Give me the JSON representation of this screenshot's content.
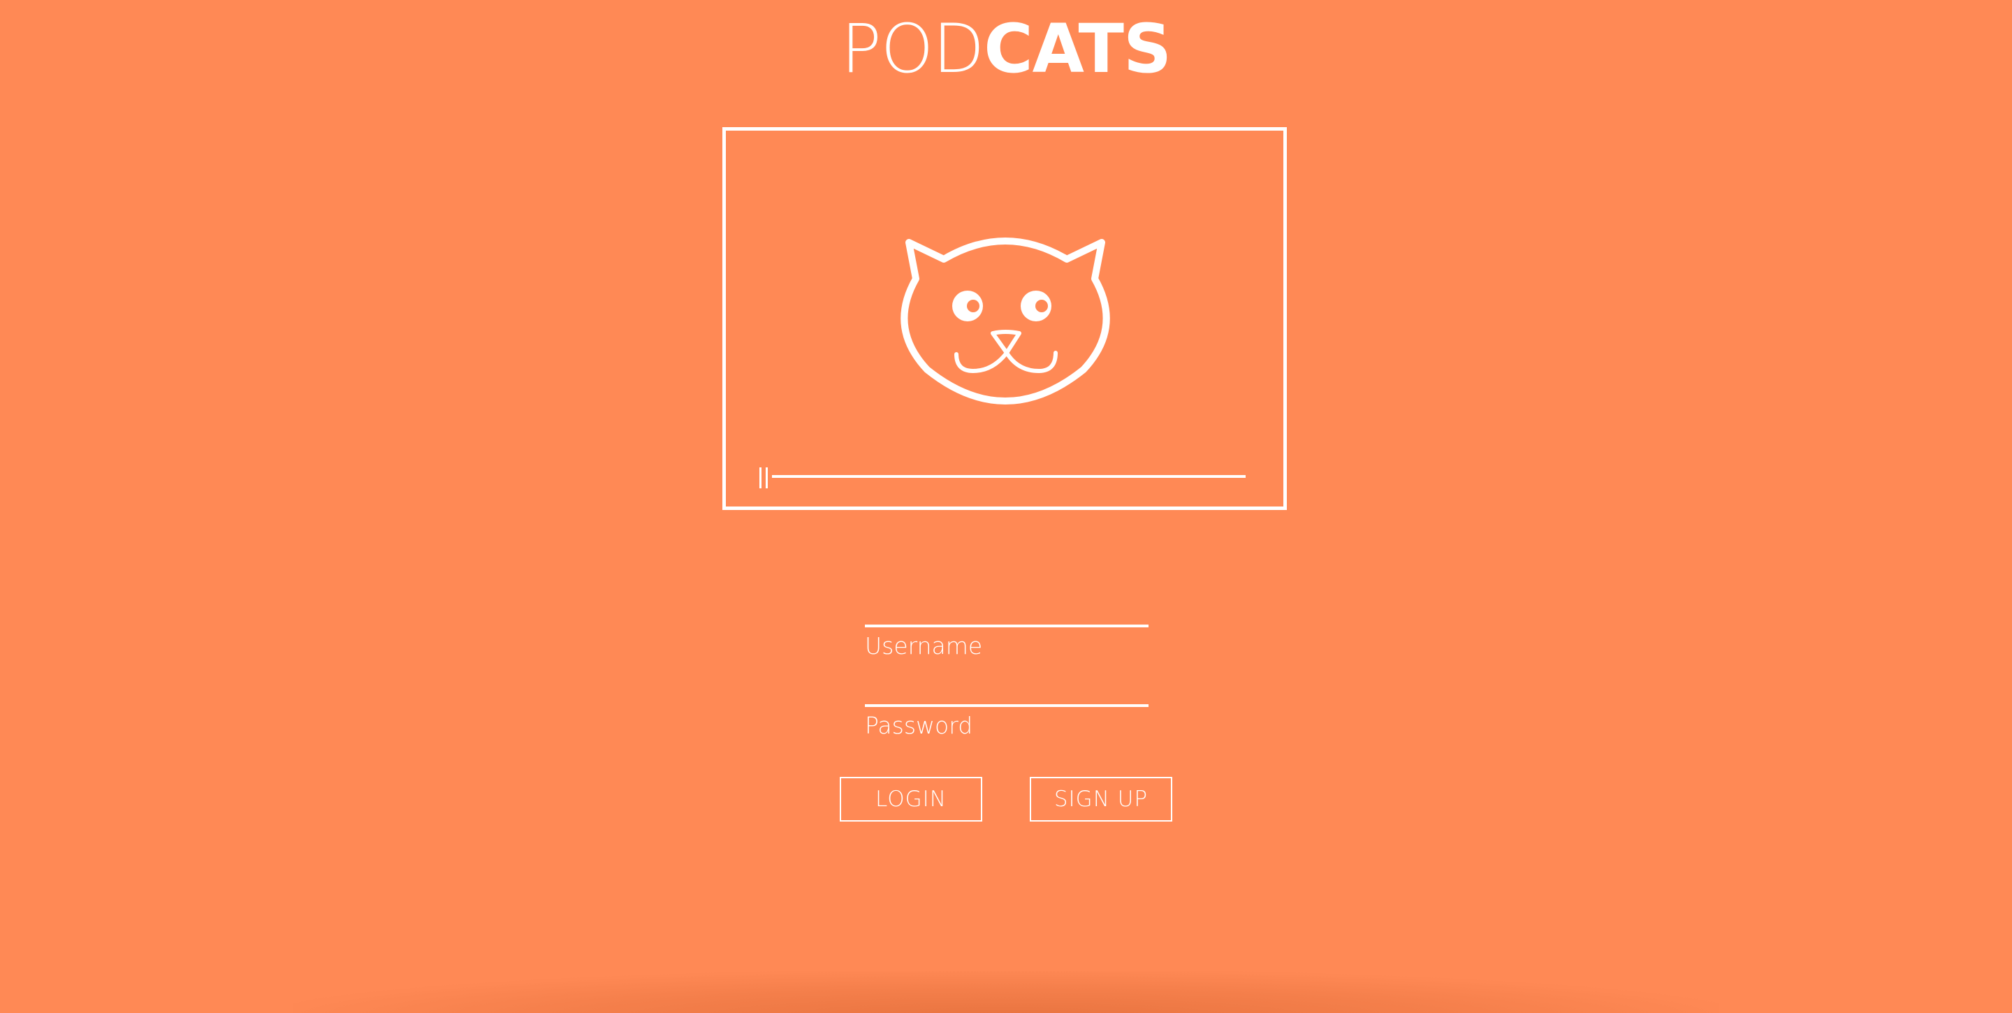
{
  "brand": {
    "prefix": "POD",
    "suffix": "CATS"
  },
  "player": {
    "icon": "cat-face-icon",
    "control_icon": "pause-icon",
    "progress": 0
  },
  "form": {
    "username_label": "Username",
    "username_value": "",
    "password_label": "Password",
    "password_value": ""
  },
  "buttons": {
    "login": "LOGIN",
    "signup": "SIGN UP"
  },
  "colors": {
    "background": "#ff8955",
    "foreground": "#ffffff"
  }
}
